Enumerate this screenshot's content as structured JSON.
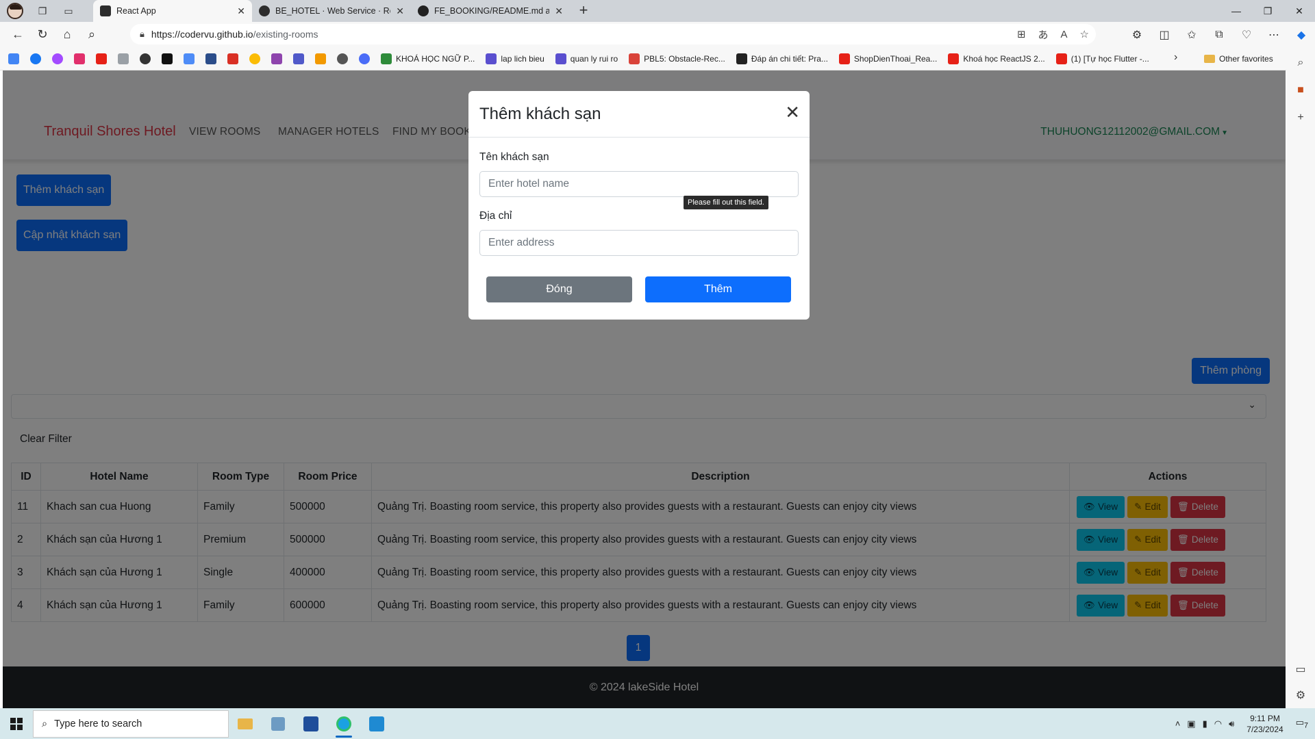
{
  "browser": {
    "tabs": [
      {
        "title": "React App",
        "active": true,
        "favicon_color": "#2d2d2d"
      },
      {
        "title": "BE_HOTEL · Web Service · Rende",
        "active": false,
        "favicon_color": "#2d2d2d"
      },
      {
        "title": "FE_BOOKING/README.md at de",
        "active": false,
        "favicon_color": "#222222"
      }
    ],
    "url_host": "https://codervu.github.io",
    "url_path": "/existing-rooms",
    "bookmarks": [
      {
        "label": "KHOÁ HỌC NGỮ P...",
        "color": "#2e8b3a"
      },
      {
        "label": "lap lich bieu",
        "color": "#5a4fcf"
      },
      {
        "label": "quan ly rui ro",
        "color": "#5a4fcf"
      },
      {
        "label": "PBL5: Obstacle-Rec...",
        "color": "#d9433a"
      },
      {
        "label": "Đáp án chi tiết: Pra...",
        "color": "#222222"
      },
      {
        "label": "ShopDienThoai_Rea...",
        "color": "#e62117"
      },
      {
        "label": "Khoá học ReactJS 2...",
        "color": "#e62117"
      },
      {
        "label": "(1) [Tự học Flutter -...",
        "color": "#e62117"
      }
    ],
    "other_favorites": "Other favorites"
  },
  "site": {
    "brand": "Tranquil Shores Hotel",
    "nav": [
      "VIEW ROOMS",
      "MANAGER HOTELS",
      "FIND MY BOOKING"
    ],
    "user": "THUHUONG12112002@GMAIL.COM",
    "add_hotel_button": "Thêm khách sạn",
    "update_hotel_button": "Cập nhật khách sạn",
    "add_room_button": "Thêm phòng",
    "clear_filter": "Clear Filter",
    "table": {
      "headers": [
        "ID",
        "Hotel Name",
        "Room Type",
        "Room Price",
        "Description",
        "Actions"
      ],
      "rows": [
        {
          "id": "11",
          "hotel": "Khach san cua Huong",
          "type": "Family",
          "price": "500000",
          "desc": "Quảng Trị. Boasting room service, this property also provides guests with a restaurant. Guests can enjoy city views"
        },
        {
          "id": "2",
          "hotel": "Khách sạn của Hương 1",
          "type": "Premium",
          "price": "500000",
          "desc": "Quảng Trị. Boasting room service, this property also provides guests with a restaurant. Guests can enjoy city views"
        },
        {
          "id": "3",
          "hotel": "Khách sạn của Hương 1",
          "type": "Single",
          "price": "400000",
          "desc": "Quảng Trị. Boasting room service, this property also provides guests with a restaurant. Guests can enjoy city views"
        },
        {
          "id": "4",
          "hotel": "Khách sạn của Hương 1",
          "type": "Family",
          "price": "600000",
          "desc": "Quảng Trị. Boasting room service, this property also provides guests with a restaurant. Guests can enjoy city views"
        }
      ],
      "actions": {
        "view": "View",
        "edit": "Edit",
        "delete": "Delete"
      }
    },
    "page_number": "1",
    "footer": "© 2024 lakeSide Hotel"
  },
  "modal": {
    "title": "Thêm khách sạn",
    "name_label": "Tên khách sạn",
    "name_placeholder": "Enter hotel name",
    "tooltip": "Please fill out this field.",
    "address_label": "Địa chỉ",
    "address_placeholder": "Enter address",
    "close_button": "Đóng",
    "submit_button": "Thêm"
  },
  "taskbar": {
    "search_placeholder": "Type here to search",
    "time": "9:11 PM",
    "date": "7/23/2024",
    "notification_count": "7"
  },
  "colors": {
    "primary": "#0d6efd",
    "brand": "#dc3545",
    "user": "#198754",
    "info": "#0dcaf0",
    "warning": "#ffc107",
    "danger": "#dc3545"
  }
}
